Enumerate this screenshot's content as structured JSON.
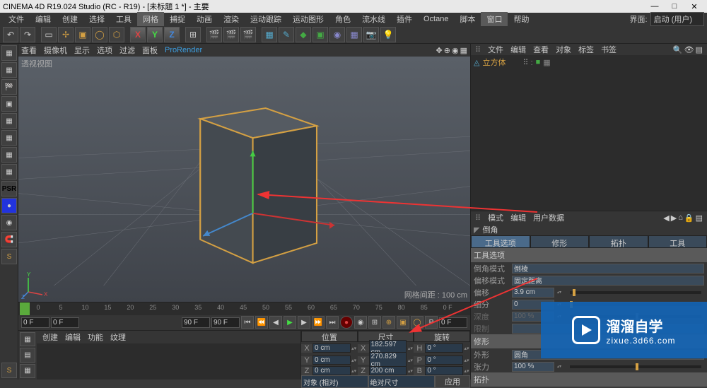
{
  "title": "CINEMA 4D R19.024 Studio (RC - R19) - [未标题 1 *] - 主要",
  "menubar": {
    "items": [
      "文件",
      "编辑",
      "创建",
      "选择",
      "工具",
      "网格",
      "捕捉",
      "动画",
      "渲染",
      "运动跟踪",
      "运动图形",
      "角色",
      "流水线",
      "插件",
      "Octane",
      "脚本",
      "窗口",
      "帮助"
    ],
    "right_label": "界面:",
    "right_value": "启动 (用户)"
  },
  "view_menu": {
    "items": [
      "查看",
      "摄像机",
      "显示",
      "选项",
      "过滤",
      "面板"
    ],
    "renderer": "ProRender"
  },
  "viewport": {
    "label": "透视视图",
    "grid_distance": "网格间距 : 100 cm"
  },
  "timeline": {
    "frame_start": "0 F",
    "frame_end": "90 F",
    "zoom_start": "0 F",
    "zoom_end": "90 F",
    "cur_frame": "0 F",
    "ticks": [
      "0",
      "5",
      "10",
      "15",
      "20",
      "25",
      "30",
      "35",
      "40",
      "45",
      "50",
      "55",
      "60",
      "65",
      "70",
      "75",
      "80",
      "85",
      "0 F"
    ]
  },
  "bottom_tabs": [
    "创建",
    "编辑",
    "功能",
    "纹理"
  ],
  "right_panel": {
    "tabs": [
      "文件",
      "编辑",
      "查看",
      "对象",
      "标签",
      "书签"
    ],
    "object_name": "立方体"
  },
  "attr_panel": {
    "tabs": [
      "模式",
      "编辑",
      "用户数据"
    ],
    "tool_title": "倒角",
    "tool_tabs": [
      "工具选项",
      "修形",
      "拓扑",
      "工具"
    ],
    "section1": "工具选项",
    "rows": {
      "mode_label": "倒角模式",
      "mode_value": "倒棱",
      "offset_mode_label": "偏移模式",
      "offset_mode_value": "固定距离",
      "offset_label": "偏移",
      "offset_value": "3.9 cm",
      "subdiv_label": "细分",
      "subdiv_value": "0",
      "depth_label": "深度",
      "depth_value": "100 %",
      "limit_label": "限制",
      "limit_value": ""
    },
    "section2": "修形",
    "rows2": {
      "shape_label": "外形",
      "shape_value": "圆角",
      "tension_label": "张力",
      "tension_value": "100 %"
    },
    "section3": "拓扑"
  },
  "coords": {
    "headers": [
      "位置",
      "尺寸",
      "旋转"
    ],
    "rows": [
      {
        "axis": "X",
        "pos": "0 cm",
        "size": "182.597 cm",
        "rot_lbl": "H",
        "rot": "0 °"
      },
      {
        "axis": "Y",
        "pos": "0 cm",
        "size": "270.829 cm",
        "rot_lbl": "P",
        "rot": "0 °"
      },
      {
        "axis": "Z",
        "pos": "0 cm",
        "size": "200 cm",
        "rot_lbl": "B",
        "rot": "0 °"
      }
    ],
    "mode": "对象 (相对)",
    "size_mode": "绝对尺寸",
    "apply": "应用"
  },
  "watermark": {
    "main": "溜溜自学",
    "sub": "zixue.3d66.com"
  }
}
